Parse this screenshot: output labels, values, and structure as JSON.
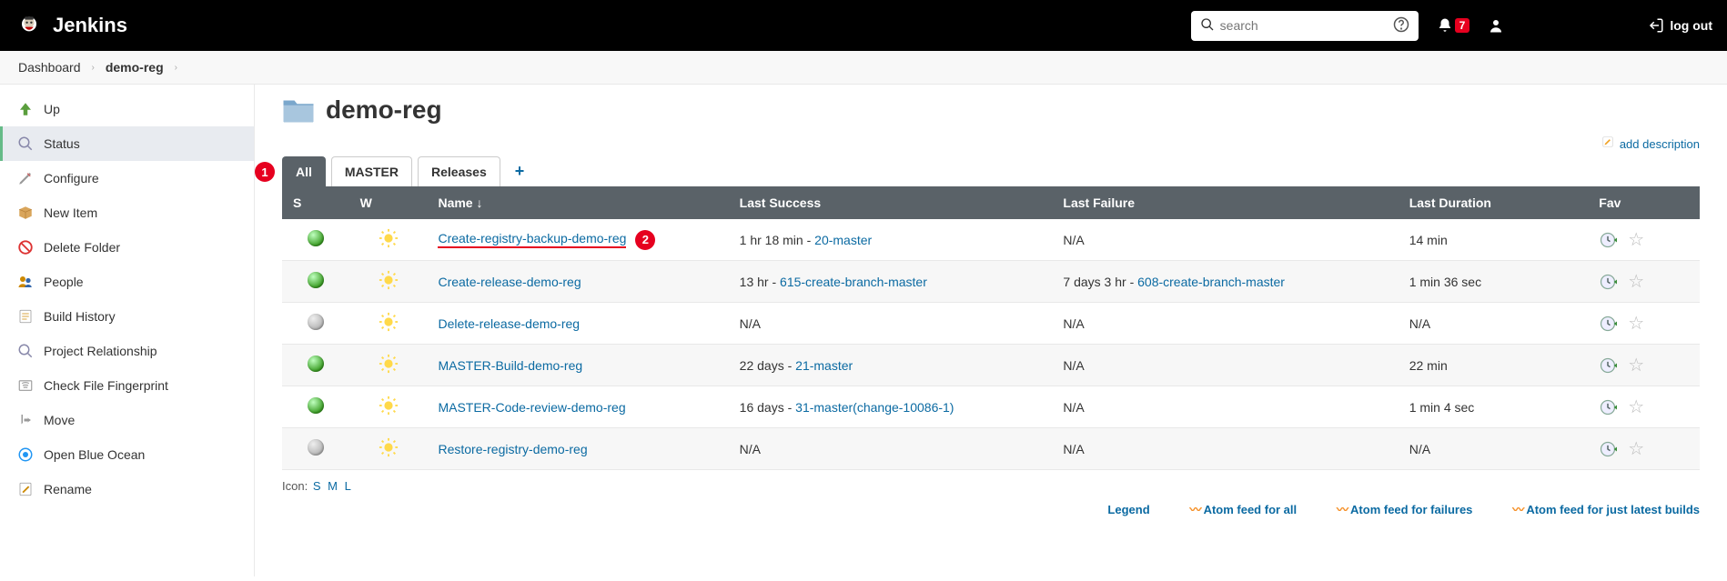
{
  "header": {
    "brand": "Jenkins",
    "search_placeholder": "search",
    "notification_count": "7",
    "logout": "log out"
  },
  "breadcrumb": {
    "items": [
      "Dashboard",
      "demo-reg"
    ]
  },
  "sidebar": {
    "items": [
      {
        "label": "Up",
        "icon": "up"
      },
      {
        "label": "Status",
        "icon": "status",
        "active": true
      },
      {
        "label": "Configure",
        "icon": "configure"
      },
      {
        "label": "New Item",
        "icon": "newitem"
      },
      {
        "label": "Delete Folder",
        "icon": "delete"
      },
      {
        "label": "People",
        "icon": "people"
      },
      {
        "label": "Build History",
        "icon": "history"
      },
      {
        "label": "Project Relationship",
        "icon": "relation"
      },
      {
        "label": "Check File Fingerprint",
        "icon": "fingerprint"
      },
      {
        "label": "Move",
        "icon": "move"
      },
      {
        "label": "Open Blue Ocean",
        "icon": "blueocean"
      },
      {
        "label": "Rename",
        "icon": "rename"
      }
    ]
  },
  "page": {
    "title": "demo-reg",
    "add_description": "add description"
  },
  "tabs": [
    "All",
    "MASTER",
    "Releases"
  ],
  "active_tab": 0,
  "table": {
    "headers": {
      "s": "S",
      "w": "W",
      "name": "Name  ↓",
      "ls": "Last Success",
      "lf": "Last Failure",
      "ld": "Last Duration",
      "fav": "Fav"
    },
    "rows": [
      {
        "status": "green",
        "name": "Create-registry-backup-demo-reg",
        "annotated": true,
        "ls_text": "1 hr 18 min - ",
        "ls_link": "20-master",
        "lf_text": "N/A",
        "lf_link": "",
        "ld": "14 min"
      },
      {
        "status": "green",
        "name": "Create-release-demo-reg",
        "ls_text": "13 hr - ",
        "ls_link": "615-create-branch-master",
        "lf_text": "7 days 3 hr - ",
        "lf_link": "608-create-branch-master",
        "ld": "1 min 36 sec"
      },
      {
        "status": "grey",
        "name": "Delete-release-demo-reg",
        "ls_text": "N/A",
        "ls_link": "",
        "lf_text": "N/A",
        "lf_link": "",
        "ld": "N/A"
      },
      {
        "status": "green",
        "name": "MASTER-Build-demo-reg",
        "ls_text": "22 days - ",
        "ls_link": "21-master",
        "lf_text": "N/A",
        "lf_link": "",
        "ld": "22 min"
      },
      {
        "status": "green",
        "name": "MASTER-Code-review-demo-reg",
        "ls_text": "16 days - ",
        "ls_link": "31-master(change-10086-1)",
        "lf_text": "N/A",
        "lf_link": "",
        "ld": "1 min 4 sec"
      },
      {
        "status": "grey",
        "name": "Restore-registry-demo-reg",
        "ls_text": "N/A",
        "ls_link": "",
        "lf_text": "N/A",
        "lf_link": "",
        "ld": "N/A"
      }
    ]
  },
  "iconsize": {
    "label": "Icon:",
    "s": "S",
    "m": "M",
    "l": "L"
  },
  "footer": {
    "legend": "Legend",
    "atom_all": "Atom feed for all",
    "atom_fail": "Atom feed for failures",
    "atom_latest": "Atom feed for just latest builds"
  },
  "annotations": {
    "a1": "1",
    "a2": "2"
  }
}
